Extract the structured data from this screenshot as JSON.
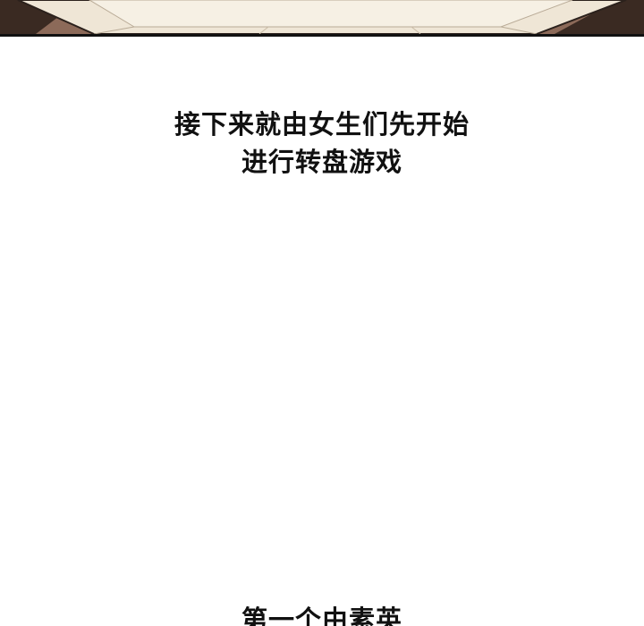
{
  "panel_top": {
    "description_colors": {
      "plate": "#f3ecde",
      "rim": "#e1d3bf",
      "edge_dark": "#2b211c",
      "table": "#8c6a59"
    }
  },
  "caption_main": {
    "line1": "接下来就由女生们先开始",
    "line2": "进行转盘游戏"
  },
  "caption_bottom": {
    "text": "第一个由素英"
  }
}
